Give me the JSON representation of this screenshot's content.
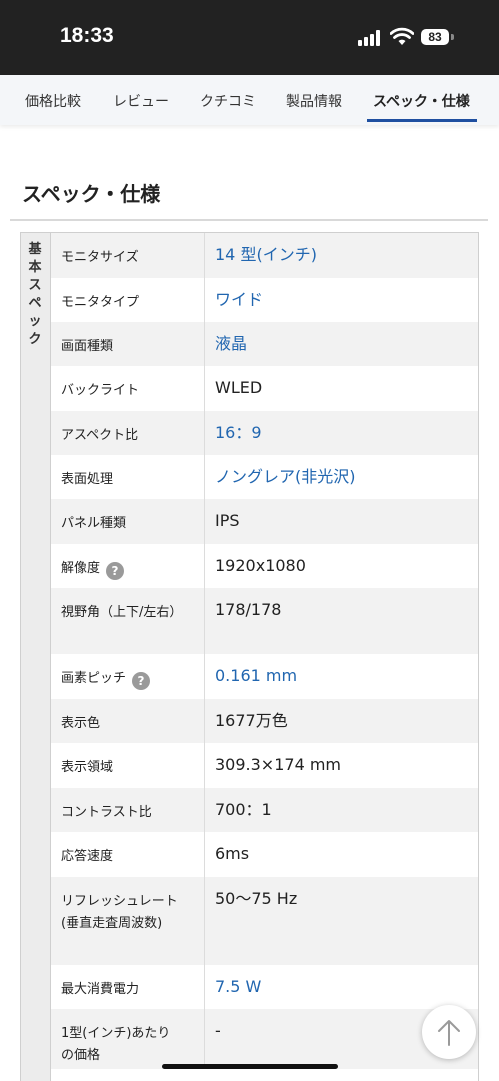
{
  "status_bar": {
    "time": "18:33",
    "battery": "83"
  },
  "tabs": [
    {
      "label": "価格比較"
    },
    {
      "label": "レビュー"
    },
    {
      "label": "クチコミ"
    },
    {
      "label": "製品情報"
    },
    {
      "label": "スペック・仕様",
      "active": true
    }
  ],
  "section_title": "スペック・仕様",
  "group_label": "基本スペック",
  "specs": [
    {
      "label": "モニタサイズ",
      "value": "14 型(インチ)",
      "link": true
    },
    {
      "label": "モニタタイプ",
      "value": "ワイド",
      "link": true
    },
    {
      "label": "画面種類",
      "value": "液晶",
      "link": true
    },
    {
      "label": "バックライト",
      "value": "WLED",
      "link": false
    },
    {
      "label": "アスペクト比",
      "value": "16：9",
      "link": true
    },
    {
      "label": "表面処理",
      "value": "ノングレア(非光沢)",
      "link": true
    },
    {
      "label": "パネル種類",
      "value": "IPS",
      "link": false
    },
    {
      "label": "解像度",
      "value": "1920x1080",
      "link": false,
      "help": true
    },
    {
      "label": "視野角（上下/左右）",
      "value": "178/178",
      "link": false
    },
    {
      "label": "画素ピッチ",
      "value": "0.161 mm",
      "link": true,
      "help": true
    },
    {
      "label": "表示色",
      "value": "1677万色",
      "link": false
    },
    {
      "label": "表示領域",
      "value": "309.3×174 mm",
      "link": false
    },
    {
      "label": "コントラスト比",
      "value": "700：1",
      "link": false
    },
    {
      "label": "応答速度",
      "value": "6ms",
      "link": false
    },
    {
      "label": "リフレッシュレート(垂直走査周波数)",
      "value": "50〜75 Hz",
      "link": false
    },
    {
      "label": "最大消費電力",
      "value": "7.5 W",
      "link": true
    },
    {
      "label": "1型(インチ)あたりの価格",
      "value": "-",
      "link": false
    }
  ],
  "help_icon_glyph": "?",
  "scroll_top_icon": "arrow-up-icon"
}
